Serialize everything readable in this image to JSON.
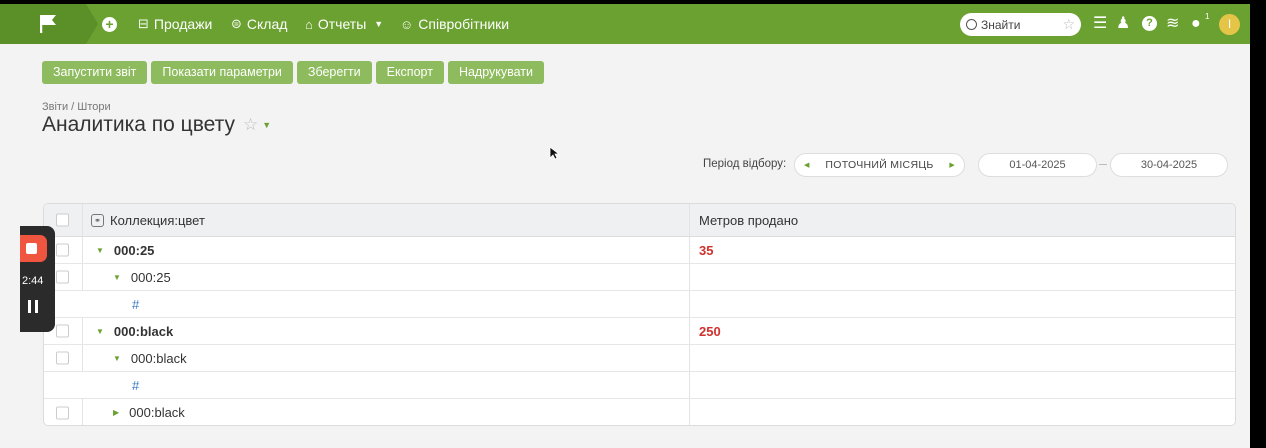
{
  "nav": {
    "items": [
      {
        "label": "Продажи",
        "icon": "columns-icon",
        "glyph": "⊟"
      },
      {
        "label": "Склад",
        "icon": "circle-lines-icon",
        "glyph": "⊜"
      },
      {
        "label": "Отчеты",
        "icon": "buildings-icon",
        "glyph": "⌂"
      },
      {
        "label": "Співробітники",
        "icon": "users-icon",
        "glyph": "☺"
      }
    ],
    "search_placeholder": "Знайти",
    "notification_count": "1",
    "avatar_letter": "I",
    "accent_color": "#6aa130"
  },
  "toolbar": {
    "run": "Запустити звіт",
    "params": "Показати параметри",
    "save": "Зберегти",
    "export": "Експорт",
    "print": "Надрукувати"
  },
  "breadcrumb": "Звіти / Штори",
  "title": "Аналитика по цвету",
  "period": {
    "label": "Період відбору:",
    "value": "ПОТОЧНИЙ МІСЯЦЬ",
    "date_from": "01-04-2025",
    "date_to": "30-04-2025"
  },
  "table": {
    "col1": "Коллекция:цвет",
    "col2": "Метров продано",
    "rows": [
      {
        "name": "000:25",
        "value": "35"
      },
      {
        "name": "000:25",
        "value": ""
      },
      {
        "name": "#",
        "value": ""
      },
      {
        "name": "000:black",
        "value": "250"
      },
      {
        "name": "000:black",
        "value": ""
      },
      {
        "name": "#",
        "value": ""
      },
      {
        "name": "000:black",
        "value": ""
      }
    ]
  },
  "recorder": {
    "time": "2:44"
  }
}
